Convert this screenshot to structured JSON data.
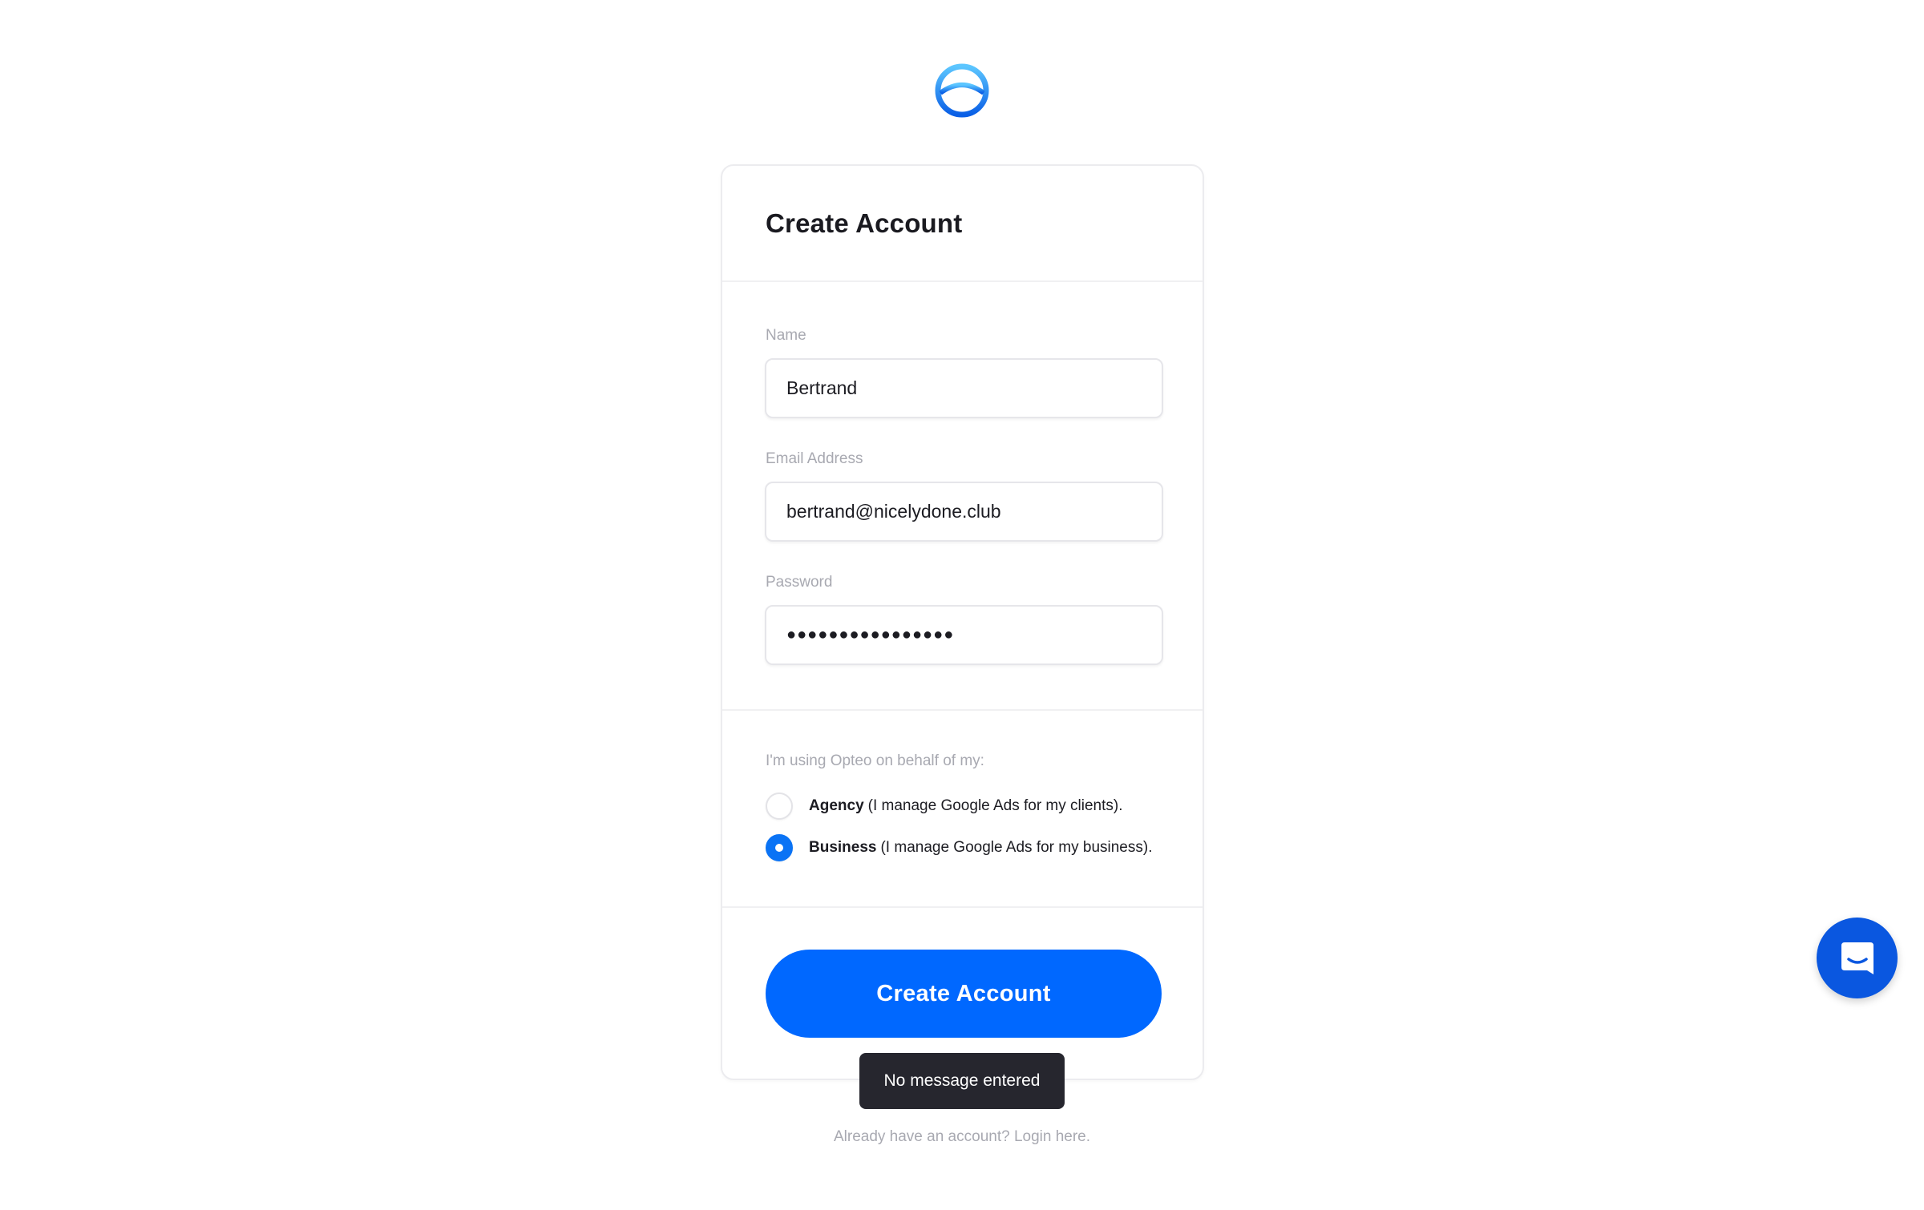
{
  "logo": {
    "icon": "opteo-logo-icon",
    "accent": "#0a73f5"
  },
  "card": {
    "title": "Create Account",
    "fields": {
      "name": {
        "label": "Name",
        "value": "Bertrand"
      },
      "email": {
        "label": "Email Address",
        "value": "bertrand@nicelydone.club"
      },
      "password": {
        "label": "Password",
        "value": "●●●●●●●●●●●●●●●●"
      }
    },
    "usage": {
      "prompt": "I'm using Opteo on behalf of my:",
      "options": [
        {
          "bold": "Agency",
          "rest": "(I manage Google Ads for my clients).",
          "checked": false
        },
        {
          "bold": "Business",
          "rest": "(I manage Google Ads for my business).",
          "checked": true
        }
      ]
    },
    "submit_label": "Create Account"
  },
  "tooltip": "No message entered",
  "login_prompt": "Already have an account? Login here.",
  "chat": {
    "icon": "chat-icon",
    "color": "#0a57e0"
  },
  "colors": {
    "primary": "#0068ff",
    "tooltip_bg": "#26262e"
  }
}
